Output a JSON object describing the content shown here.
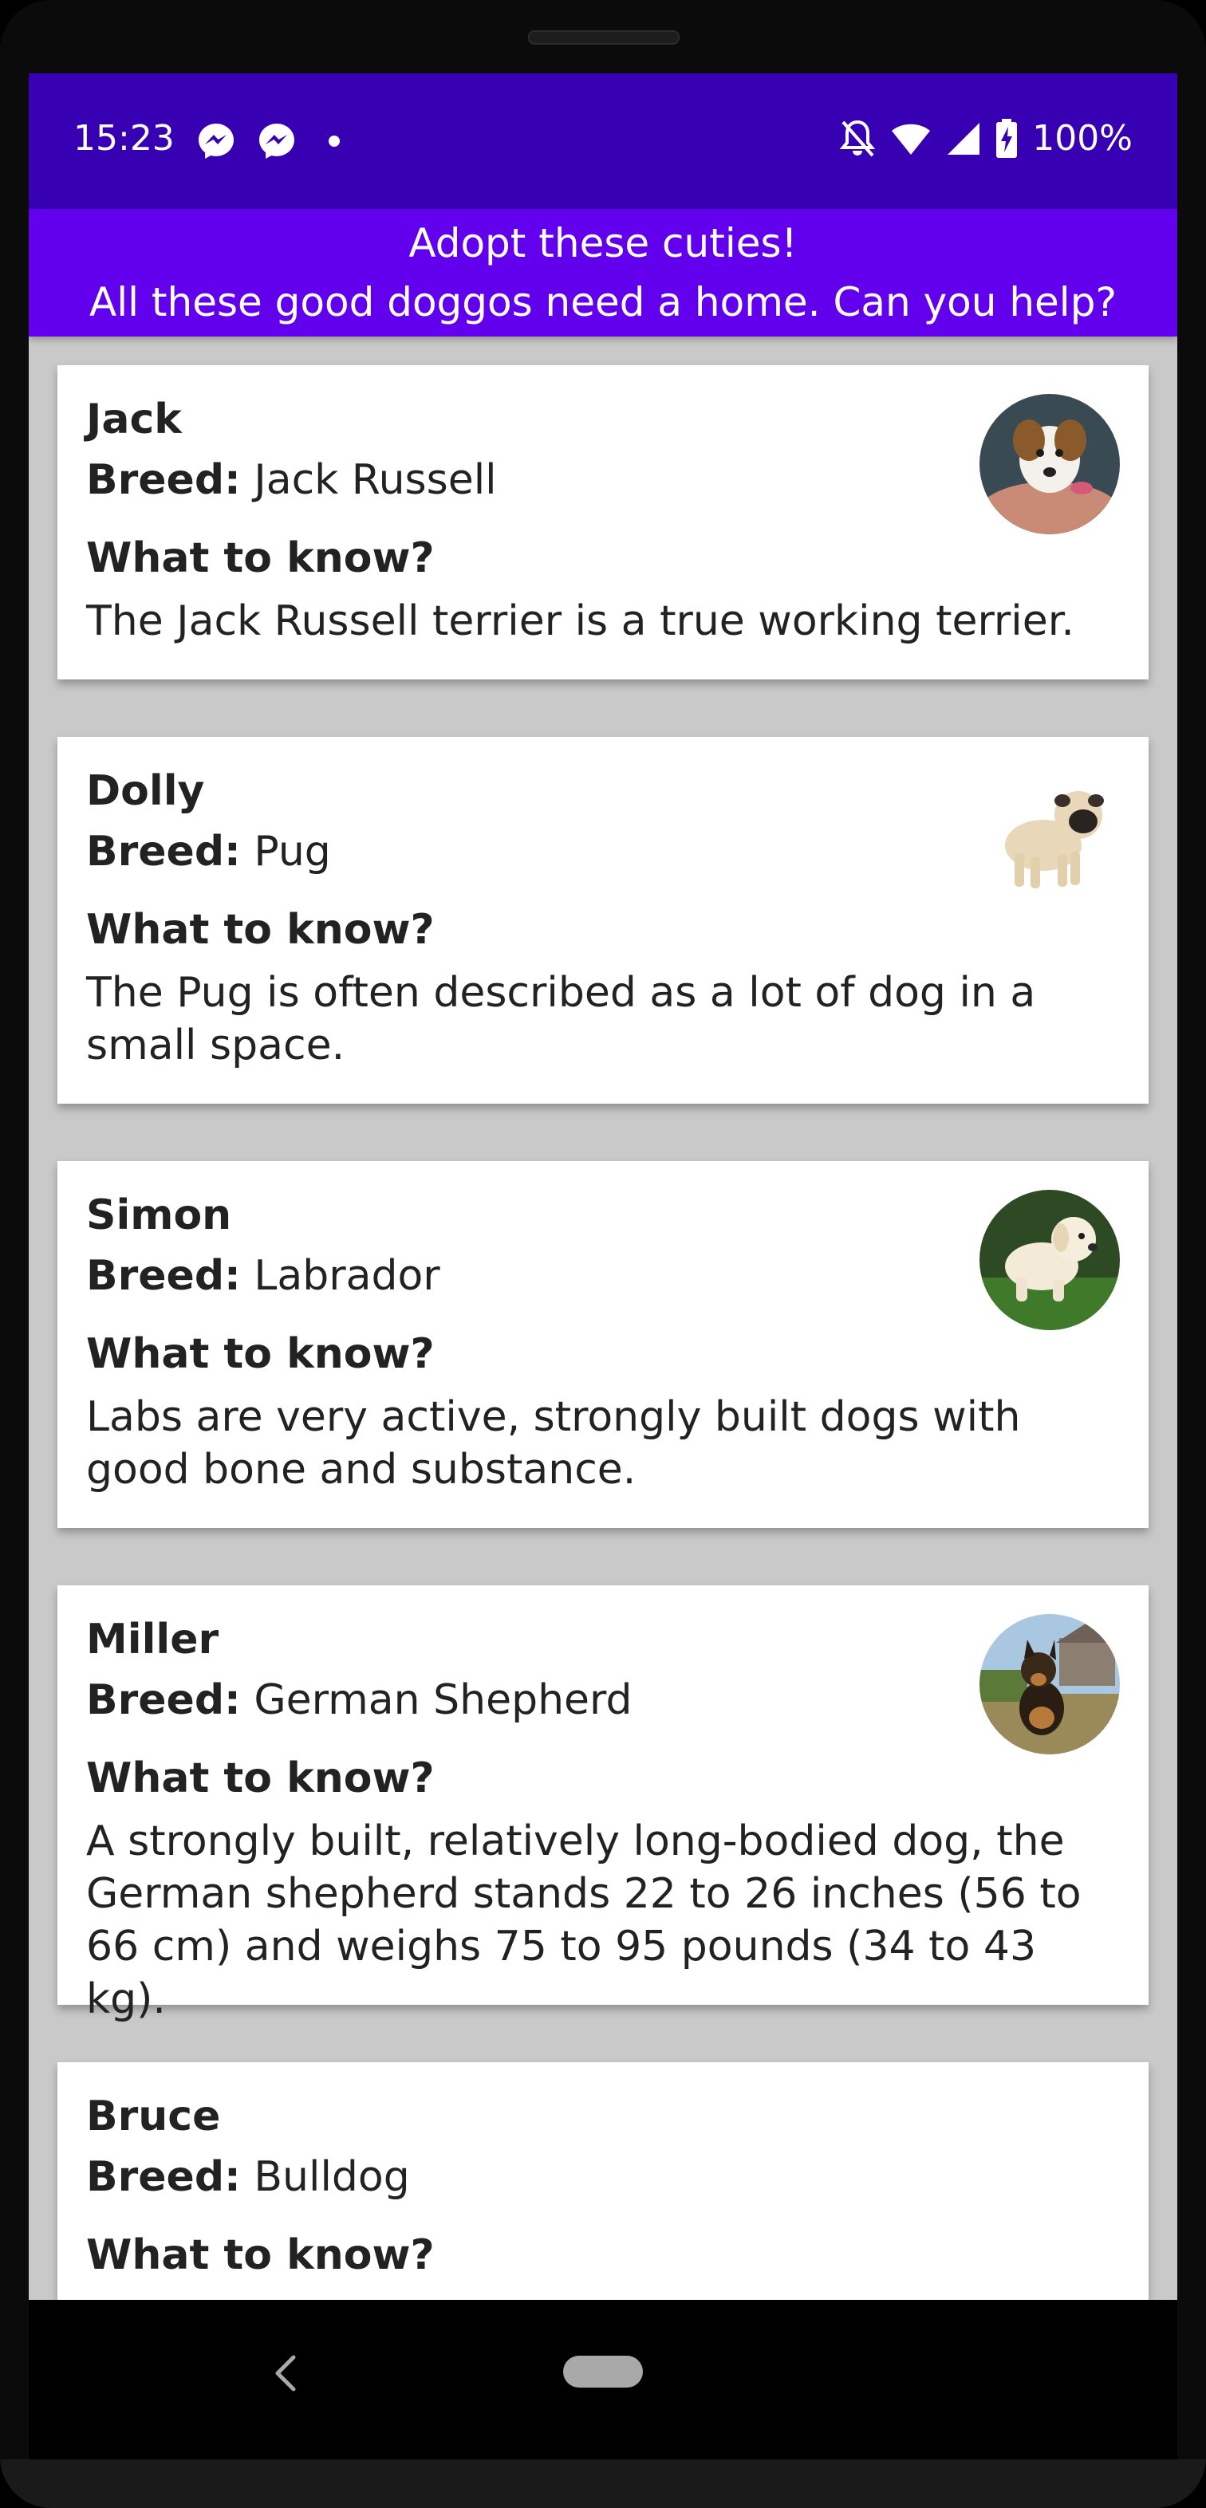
{
  "status_bar": {
    "time": "15:23",
    "battery_percent": "100%",
    "left_icons": [
      "messenger-icon",
      "messenger-icon",
      "notification-dot-icon"
    ],
    "right_icons": [
      "bell-off-icon",
      "wifi-icon",
      "signal-icon",
      "battery-charging-icon"
    ],
    "background": "#3700b3"
  },
  "header": {
    "title": "Adopt these cuties!",
    "subtitle": "All these good doggos need a home. Can you help?",
    "background": "#6200ee"
  },
  "labels": {
    "breed": "Breed:",
    "what_to_know": "What to know?"
  },
  "dogs": [
    {
      "name": "Jack",
      "breed": "Jack Russell",
      "what_to_know": "What to know?",
      "description": "The Jack Russell terrier is a true working terrier.",
      "photo": "jack-russell-puppy-photo"
    },
    {
      "name": "Dolly",
      "breed": "Pug",
      "what_to_know": "What to know?",
      "description": "The Pug is often described as a lot of dog in a small space.",
      "photo": "pug-puppy-photo"
    },
    {
      "name": "Simon",
      "breed": "Labrador",
      "what_to_know": "What to know?",
      "description": "Labs are very active, strongly built dogs with good bone and substance.",
      "photo": "labrador-puppy-photo"
    },
    {
      "name": "Miller",
      "breed": "German Shepherd",
      "what_to_know": "What to know?",
      "description": "A strongly built, relatively long-bodied dog, the German shepherd stands 22 to 26 inches (56 to 66 cm) and weighs 75 to 95 pounds (34 to 43 kg).",
      "photo": "german-shepherd-puppy-photo"
    },
    {
      "name": "Bruce",
      "breed": "Bulldog",
      "what_to_know": "What to know?",
      "description": "",
      "photo": ""
    }
  ],
  "nav": {
    "icons": [
      "back-icon",
      "home-pill-icon"
    ]
  }
}
